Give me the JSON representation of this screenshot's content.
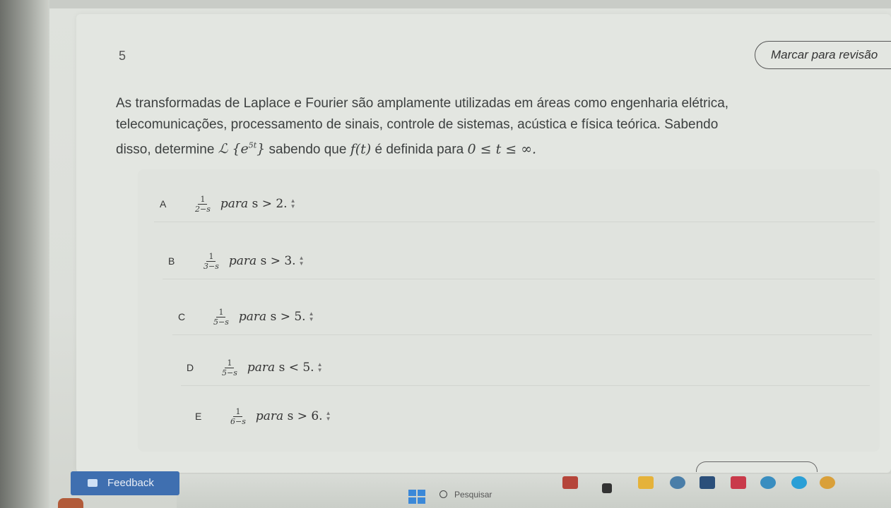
{
  "question": {
    "number": "5",
    "mark_review_label": "Marcar para revisão",
    "line1": "As transformadas de Laplace e Fourier são amplamente utilizadas em áreas como engenharia elétrica,",
    "line2": "telecomunicações, processamento de sinais, controle de sistemas, acústica e física teórica. Sabendo",
    "line3_prefix": "disso, determine",
    "laplace_expr": "ℒ {e",
    "laplace_exp": "5t",
    "laplace_close": "}",
    "line3_mid": "sabendo que",
    "func": "f(t)",
    "line3_after": "é definida para",
    "domain": "0 ≤ t ≤ ∞."
  },
  "options": [
    {
      "letter": "A",
      "num": "1",
      "den": "2−s",
      "word": "para",
      "cond": "s > 2."
    },
    {
      "letter": "B",
      "num": "1",
      "den": "3−s",
      "word": "para",
      "cond": "s > 3."
    },
    {
      "letter": "C",
      "num": "1",
      "den": "5−s",
      "word": "para",
      "cond": "s > 5."
    },
    {
      "letter": "D",
      "num": "1",
      "den": "5−s",
      "word": "para",
      "cond": "s < 5."
    },
    {
      "letter": "E",
      "num": "1",
      "den": "6−s",
      "word": "para",
      "cond": "s > 6."
    }
  ],
  "footer": {
    "feedback_label": "Feedback",
    "search_placeholder": "Pesquisar"
  },
  "colors": {
    "feedback_bg": "#3f6fb0",
    "windows_blue": "#3b88d8"
  }
}
